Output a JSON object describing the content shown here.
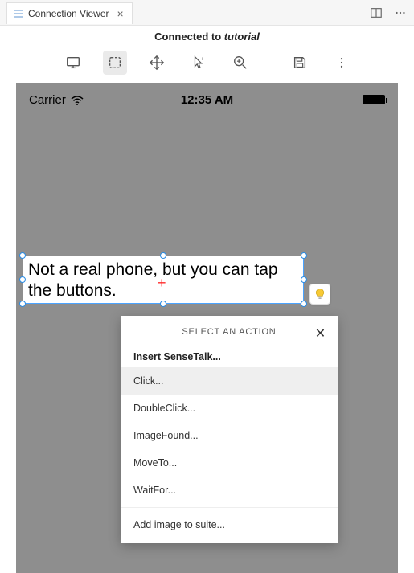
{
  "titlebar": {
    "tab_label": "Connection Viewer"
  },
  "header": {
    "connected_prefix": "Connected to ",
    "connected_target": "tutorial"
  },
  "statusbar": {
    "carrier": "Carrier",
    "time": "12:35 AM"
  },
  "selection": {
    "text": "Not a real phone, but you can tap the buttons."
  },
  "popup": {
    "title": "SELECT AN ACTION",
    "section_label": "Insert SenseTalk...",
    "items": [
      "Click...",
      "DoubleClick...",
      "ImageFound...",
      "MoveTo...",
      "WaitFor..."
    ],
    "footer_item": "Add image to suite..."
  }
}
